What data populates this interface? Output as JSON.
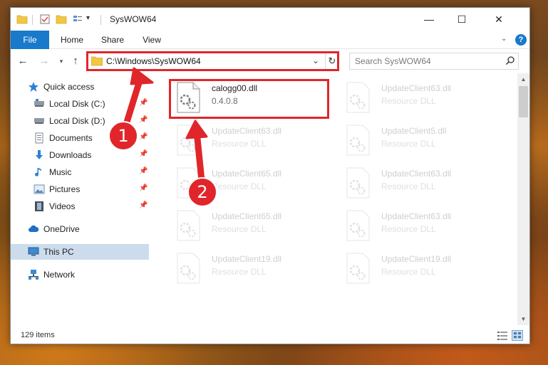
{
  "window": {
    "title": "SysWOW64"
  },
  "window_controls": {
    "minimize": "—",
    "maximize": "☐",
    "close": "✕"
  },
  "ribbon": {
    "tabs": [
      "File",
      "Home",
      "Share",
      "View"
    ],
    "expand": "⌄",
    "help": "?"
  },
  "address": {
    "path": "C:\\Windows\\SysWOW64",
    "dropdown": "⌄",
    "refresh": "↻"
  },
  "search": {
    "placeholder": "Search SysWOW64"
  },
  "sidebar": {
    "items": [
      {
        "label": "Quick access",
        "icon": "star-icon"
      },
      {
        "label": "Local Disk (C:)",
        "icon": "drive-icon",
        "pinned": true
      },
      {
        "label": "Local Disk (D:)",
        "icon": "drive-icon",
        "pinned": true
      },
      {
        "label": "Documents",
        "icon": "documents-icon",
        "pinned": true
      },
      {
        "label": "Downloads",
        "icon": "downloads-icon",
        "pinned": true
      },
      {
        "label": "Music",
        "icon": "music-icon",
        "pinned": true
      },
      {
        "label": "Pictures",
        "icon": "pictures-icon",
        "pinned": true
      },
      {
        "label": "Videos",
        "icon": "videos-icon",
        "pinned": true
      },
      {
        "label": "OneDrive",
        "icon": "cloud-icon"
      },
      {
        "label": "This PC",
        "icon": "computer-icon",
        "selected": true
      },
      {
        "label": "Network",
        "icon": "network-icon"
      }
    ]
  },
  "files": [
    {
      "name": "calogg00.dll",
      "type": "0.4.0.8",
      "highlighted": true
    },
    {
      "name": "UpdateClient63.dll",
      "type": "Resource DLL"
    },
    {
      "name": "UpdateClient63.dll",
      "type": "Resource DLL"
    },
    {
      "name": "UpdateClient5.dll",
      "type": "Resource DLL"
    },
    {
      "name": "UpdateClient65.dll",
      "type": "Resource DLL"
    },
    {
      "name": "UpdateClient63.dll",
      "type": "Resource DLL"
    },
    {
      "name": "UpdateClient65.dll",
      "type": "Resource DLL"
    },
    {
      "name": "UpdateClient63.dll",
      "type": "Resource DLL"
    },
    {
      "name": "UpdateClient19.dll",
      "type": "Resource DLL"
    },
    {
      "name": "UpdateClient19.dll",
      "type": "Resource DLL"
    }
  ],
  "status": {
    "item_count": "129 items"
  },
  "annotations": {
    "step1": "1",
    "step2": "2",
    "color": "#e0262b"
  },
  "colors": {
    "accent": "#1979ca",
    "selected_bg": "#ccdcec"
  }
}
